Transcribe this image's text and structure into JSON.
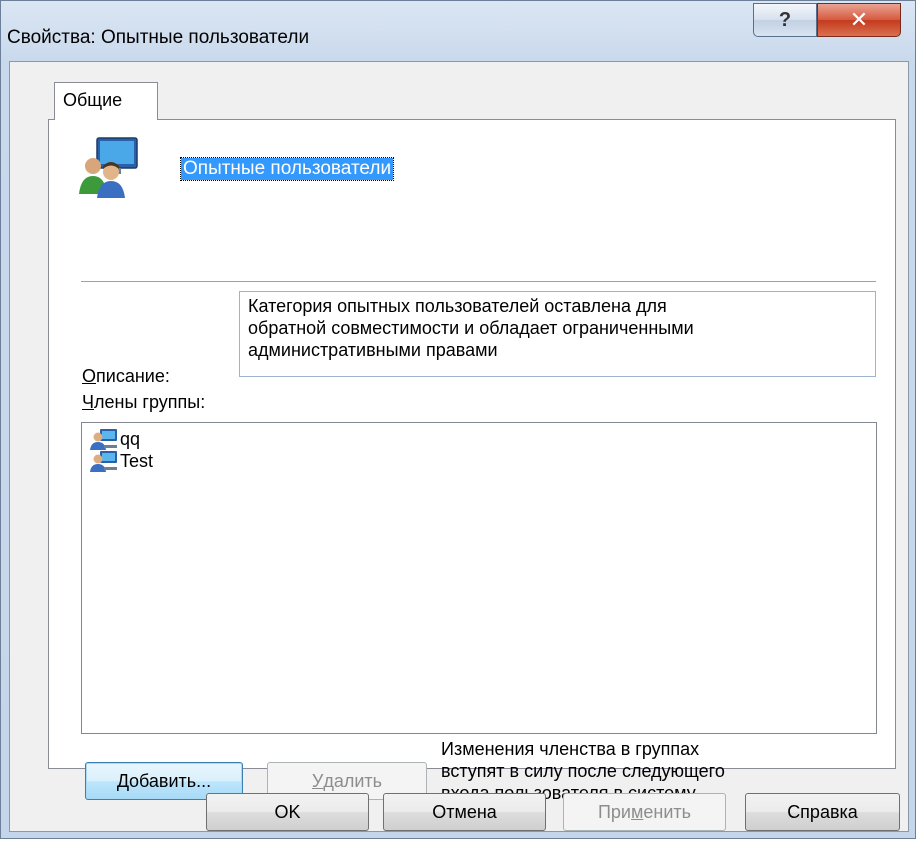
{
  "window": {
    "title": "Свойства: Опытные пользователи",
    "help_glyph": "?",
    "close_glyph": "✕"
  },
  "tabs": [
    {
      "label": "Общие",
      "active": true
    }
  ],
  "group": {
    "icon": "user-group-icon",
    "name": "Опытные пользователи"
  },
  "description": {
    "label_accel": "О",
    "label_rest": "писание:",
    "lines": [
      "Категория опытных пользователей оставлена для",
      "обратной совместимости и обладает ограниченными",
      "административными правами"
    ]
  },
  "members": {
    "label_accel": "Ч",
    "label_rest": "лены группы:",
    "items": [
      {
        "name": "qq",
        "icon": "user-icon"
      },
      {
        "name": "Test",
        "icon": "user-icon"
      }
    ]
  },
  "buttons": {
    "add": {
      "accel": "Д",
      "rest": "обавить..."
    },
    "remove": {
      "accel": "У",
      "rest": "далить"
    },
    "ok": "OK",
    "cancel": "Отмена",
    "apply": {
      "before": "При",
      "accel": "м",
      "after": "енить"
    },
    "help": "Справка"
  },
  "notice_lines": [
    "Изменения членства в группах",
    "вступят в силу после следующего",
    "входа пользователя в систему."
  ],
  "colors": {
    "selection": "#3399ff",
    "default_button_border": "#3c7fb1",
    "close_button": "#c43a1d"
  }
}
